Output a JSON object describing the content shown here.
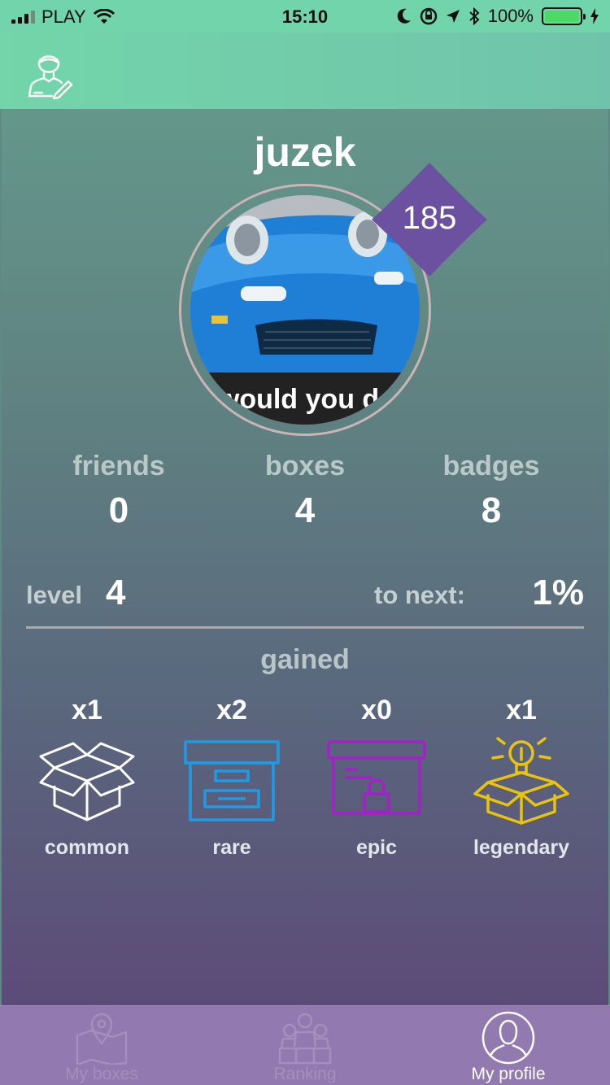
{
  "status_bar": {
    "carrier": "PLAY",
    "time": "15:10",
    "battery": "100%"
  },
  "profile": {
    "username": "juzek",
    "level_badge": "185",
    "avatar_caption": "y would you do th"
  },
  "stats": [
    {
      "label": "friends",
      "value": "0"
    },
    {
      "label": "boxes",
      "value": "4"
    },
    {
      "label": "badges",
      "value": "8"
    }
  ],
  "level": {
    "label": "level",
    "value": "4",
    "next_label": "to next:",
    "next_value": "1%"
  },
  "gained": {
    "title": "gained",
    "boxes": [
      {
        "count": "x1",
        "name": "common",
        "color": "#ffffff"
      },
      {
        "count": "x2",
        "name": "rare",
        "color": "#1e9be6"
      },
      {
        "count": "x0",
        "name": "epic",
        "color": "#a221c8"
      },
      {
        "count": "x1",
        "name": "legendary",
        "color": "#e8c40c"
      }
    ]
  },
  "tabs": [
    {
      "label": "My boxes",
      "icon": "map-pin-icon",
      "active": false
    },
    {
      "label": "Ranking",
      "icon": "ranking-group-icon",
      "active": false
    },
    {
      "label": "My profile",
      "icon": "profile-icon",
      "active": true
    }
  ],
  "colors": {
    "header": "#72d4aa",
    "tabbar": "#9279b0",
    "badge": "#6b519f"
  }
}
